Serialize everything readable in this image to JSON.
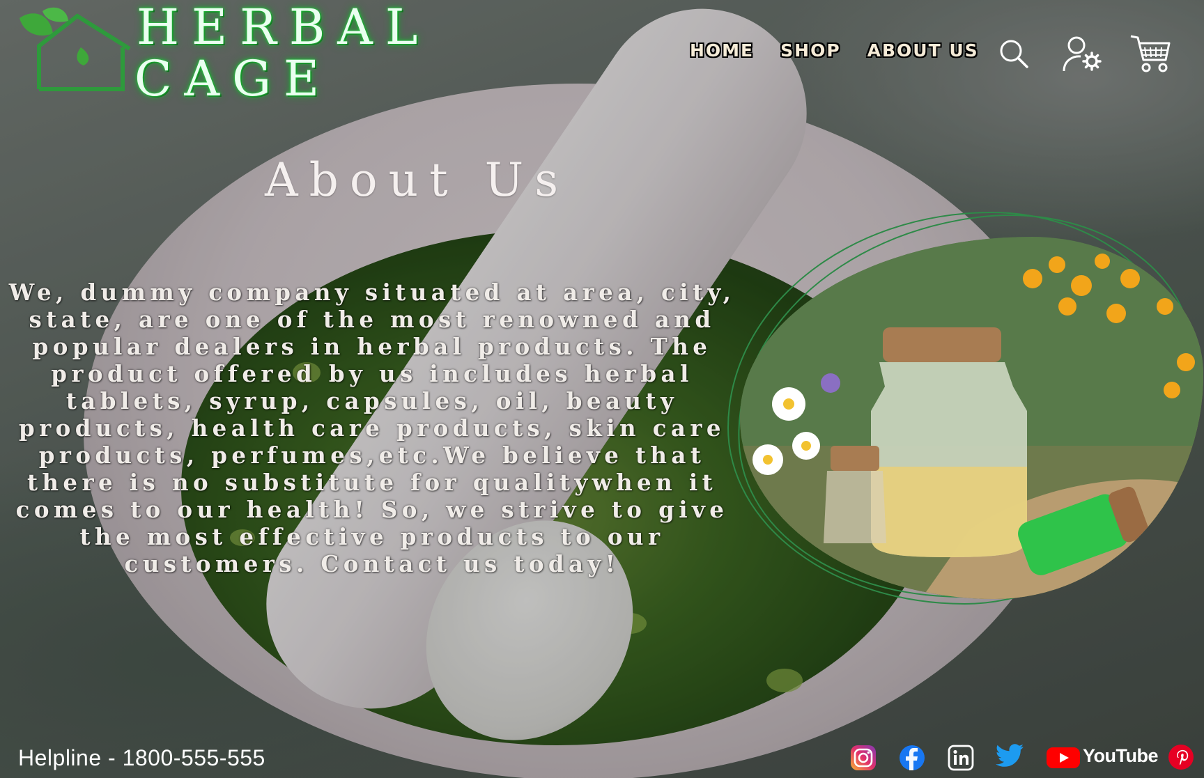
{
  "brand": {
    "line1": "HERBAL",
    "line2": "CAGE"
  },
  "nav": {
    "home": "HOME",
    "shop": "SHOP",
    "about": "ABOUT US"
  },
  "icons": {
    "search": "search-icon",
    "account": "user-settings-icon",
    "cart": "cart-icon"
  },
  "main": {
    "heading": "About Us",
    "body": "We, dummy company situated at area, city, state, are one of the most renowned and popular dealers in herbal products. The product offered by us includes herbal tablets, syrup, capsules, oil, beauty products, health care products, skin care products, perfumes,etc.We believe that there is no substitute for qualitywhen it comes to our health! So, we strive to give the most effective products to our customers. Contact us today!"
  },
  "footer": {
    "helpline": "Helpline - 1800-555-555",
    "social": [
      "instagram-icon",
      "facebook-icon",
      "linkedin-icon",
      "twitter-icon",
      "youtube-icon",
      "pinterest-icon"
    ],
    "youtube_label": "YouTube"
  },
  "colors": {
    "brand_green": "#2fd14a",
    "accent_orange": "#f2a51a"
  }
}
